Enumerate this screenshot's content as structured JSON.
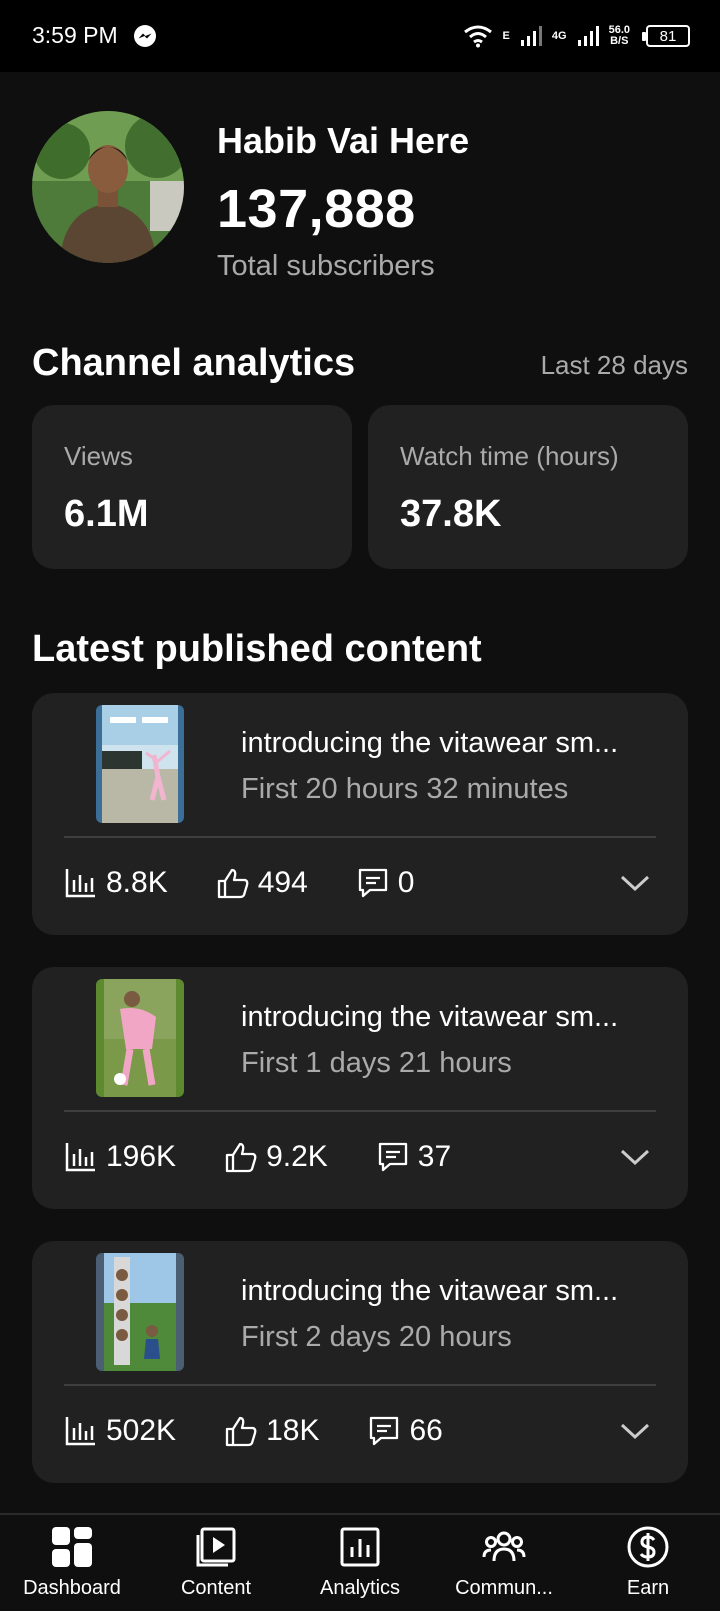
{
  "status_bar": {
    "time": "3:59 PM",
    "network_e": "E",
    "network_4g": "4G",
    "speed_value": "56.0",
    "speed_unit": "B/S",
    "battery": "81"
  },
  "channel": {
    "name": "Habib Vai Here",
    "subscriber_count": "137,888",
    "subscriber_label": "Total subscribers"
  },
  "analytics": {
    "title": "Channel analytics",
    "period": "Last 28 days",
    "metrics": [
      {
        "label": "Views",
        "value": "6.1M"
      },
      {
        "label": "Watch time (hours)",
        "value": "37.8K"
      }
    ]
  },
  "latest": {
    "title": "Latest published content",
    "items": [
      {
        "title": "introducing the vitawear sm...",
        "period": "First 20 hours 32 minutes",
        "views": "8.8K",
        "likes": "494",
        "comments": "0"
      },
      {
        "title": "introducing the vitawear sm...",
        "period": "First 1 days 21 hours",
        "views": "196K",
        "likes": "9.2K",
        "comments": "37"
      },
      {
        "title": "introducing the vitawear sm...",
        "period": "First 2 days 20 hours",
        "views": "502K",
        "likes": "18K",
        "comments": "66"
      }
    ]
  },
  "nav": {
    "items": [
      {
        "label": "Dashboard",
        "icon": "dashboard-icon"
      },
      {
        "label": "Content",
        "icon": "content-icon"
      },
      {
        "label": "Analytics",
        "icon": "analytics-icon"
      },
      {
        "label": "Commun...",
        "icon": "community-icon"
      },
      {
        "label": "Earn",
        "icon": "earn-icon"
      }
    ]
  },
  "colors": {
    "background": "#0f0f0f",
    "card": "#212121",
    "secondary_text": "#aaaaaa"
  }
}
